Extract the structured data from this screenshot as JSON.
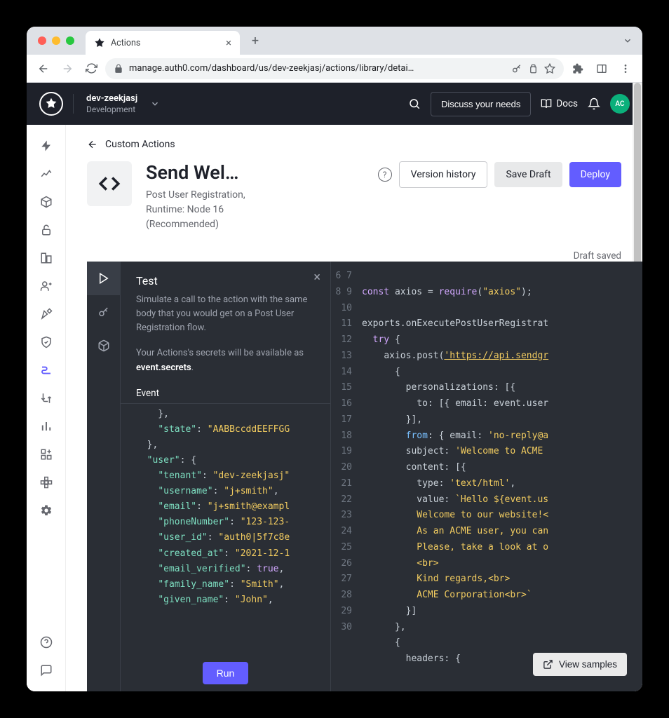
{
  "browser": {
    "tab_title": "Actions",
    "url_display": "manage.auth0.com/dashboard/us/dev-zeekjasj/actions/library/detai…"
  },
  "header": {
    "tenant_name": "dev-zeekjasj",
    "tenant_env": "Development",
    "discuss_btn": "Discuss your needs",
    "docs_label": "Docs",
    "avatar_initials": "AC"
  },
  "page": {
    "breadcrumb_back": "Custom Actions",
    "title": "Send Wel…",
    "subtitle": "Post User Registration, Runtime: Node 16 (Recommended)",
    "version_btn": "Version history",
    "save_draft_btn": "Save Draft",
    "deploy_btn": "Deploy",
    "status": "Draft saved"
  },
  "test_panel": {
    "title": "Test",
    "desc1": "Simulate a call to the action with the same body that you would get on a Post User Registration flow.",
    "desc2_prefix": "Your Actions's secrets will be available as ",
    "desc2_strong": "event.secrets",
    "event_tab": "Event",
    "run_label": "Run",
    "json": {
      "state": "AABBccddEEFFGG",
      "user": {
        "tenant": "dev-zeekjasj",
        "username": "j+smith",
        "email": "j+smith@exampl",
        "phoneNumber": "123-123-",
        "user_id": "auth0|5f7c8e",
        "created_at": "2021-12-1",
        "email_verified": true,
        "family_name": "Smith",
        "given_name": "John"
      }
    }
  },
  "code": {
    "view_samples": "View samples",
    "lines": [
      6,
      7,
      8,
      9,
      10,
      11,
      12,
      13,
      14,
      15,
      16,
      17,
      18,
      19,
      20,
      21,
      22,
      23,
      24,
      25,
      26,
      27,
      28,
      29,
      30
    ],
    "snippets": {
      "l7_const": "const",
      "l7_axios": " axios = ",
      "l7_require": "require",
      "l7_paropen": "(",
      "l7_str": "\"axios\"",
      "l7_parclose": ");",
      "l9": "exports.onExecutePostUserRegistrat",
      "l10_try": "try",
      "l10_brace": " {",
      "l11_call": "axios.post(",
      "l11_url": "'https://api.sendgr",
      "l12": "{",
      "l13": "personalizations: [{",
      "l14": "  to: [{ email: event.user",
      "l15": "}],",
      "l16_from": "from",
      "l16_rest": ": { email: ",
      "l16_str": "'no-reply@a",
      "l17_key": "subject: ",
      "l17_str": "'Welcome to ACME ",
      "l18": "content: [{",
      "l19_key": "  type: ",
      "l19_str": "'text/html'",
      "l19_comma": ",",
      "l20_key": "  value: ",
      "l20_str": "`Hello ${event.us",
      "l21": "  Welcome to our website!<",
      "l22": "  As an ACME user, you can",
      "l23": "  Please, take a look at o",
      "l24": "  <br>",
      "l25": "  Kind regards,<br>",
      "l26": "  ACME Corporation<br>`",
      "l27": "}]",
      "l28": "},",
      "l29": "{",
      "l30": "headers: {"
    }
  }
}
